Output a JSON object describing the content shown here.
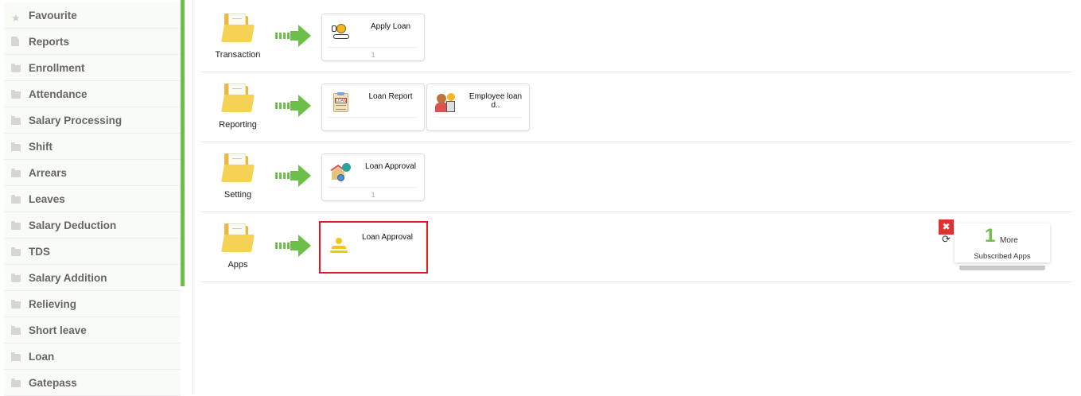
{
  "sidebar": {
    "items": [
      {
        "label": "Favourite",
        "icon": "star-icon"
      },
      {
        "label": "Reports",
        "icon": "document-icon"
      },
      {
        "label": "Enrollment",
        "icon": "folder-icon"
      },
      {
        "label": "Attendance",
        "icon": "folder-icon"
      },
      {
        "label": "Salary Processing",
        "icon": "folder-icon"
      },
      {
        "label": "Shift",
        "icon": "folder-icon"
      },
      {
        "label": "Arrears",
        "icon": "folder-icon"
      },
      {
        "label": "Leaves",
        "icon": "folder-icon"
      },
      {
        "label": "Salary Deduction",
        "icon": "folder-icon"
      },
      {
        "label": "TDS",
        "icon": "folder-icon"
      },
      {
        "label": "Salary Addition",
        "icon": "folder-icon"
      },
      {
        "label": "Relieving",
        "icon": "folder-icon"
      },
      {
        "label": "Short leave",
        "icon": "folder-icon"
      },
      {
        "label": "Loan",
        "icon": "folder-icon"
      },
      {
        "label": "Gatepass",
        "icon": "folder-icon"
      }
    ]
  },
  "rows": [
    {
      "category": "Transaction",
      "apps": [
        {
          "title": "Apply Loan",
          "count": "1",
          "icon": "loan-hand-icon"
        }
      ]
    },
    {
      "category": "Reporting",
      "apps": [
        {
          "title": "Loan Report",
          "count": "",
          "icon": "loan-report-icon"
        },
        {
          "title": "Employee loan d..",
          "count": "",
          "icon": "employee-loan-icon"
        }
      ]
    },
    {
      "category": "Setting",
      "apps": [
        {
          "title": "Loan Approval",
          "count": "1",
          "icon": "house-approval-icon"
        }
      ]
    },
    {
      "category": "Apps",
      "apps": [
        {
          "title": "Loan Approval",
          "count": "",
          "icon": "person-icon"
        }
      ]
    }
  ],
  "subscribed": {
    "count": "1",
    "more_label": "More",
    "label": "Subscribed Apps",
    "close_symbol": "✖",
    "refresh_symbol": "⟳"
  },
  "colors": {
    "accent_green": "#6cc04a",
    "highlight_red": "#e21a1a",
    "close_red": "#e03131"
  }
}
